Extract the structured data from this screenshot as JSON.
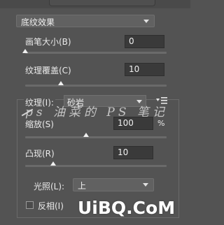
{
  "texture_type_dropdown": {
    "value": "底纹效果"
  },
  "brush_size": {
    "label": "画笔大小(B)",
    "value": "0",
    "level": 0.0
  },
  "texture_coverage": {
    "label": "纹理覆盖(C)",
    "value": "10",
    "level": 0.25
  },
  "texture": {
    "label": "纹理(I):",
    "value": "砂岩",
    "menu_icon": "panel-menu-icon"
  },
  "scaling": {
    "label": "缩放(S)",
    "value": "100",
    "unit": "%",
    "level": 0.43
  },
  "relief": {
    "label": "凸现(R)",
    "value": "10",
    "level": 0.2
  },
  "light": {
    "label": "光照(L):",
    "value": "上"
  },
  "invert": {
    "label": "反相(I)",
    "checked": false
  },
  "watermark_text": "ps 油菜的 PS 笔记",
  "logo_text": "UiBQ.CoM"
}
